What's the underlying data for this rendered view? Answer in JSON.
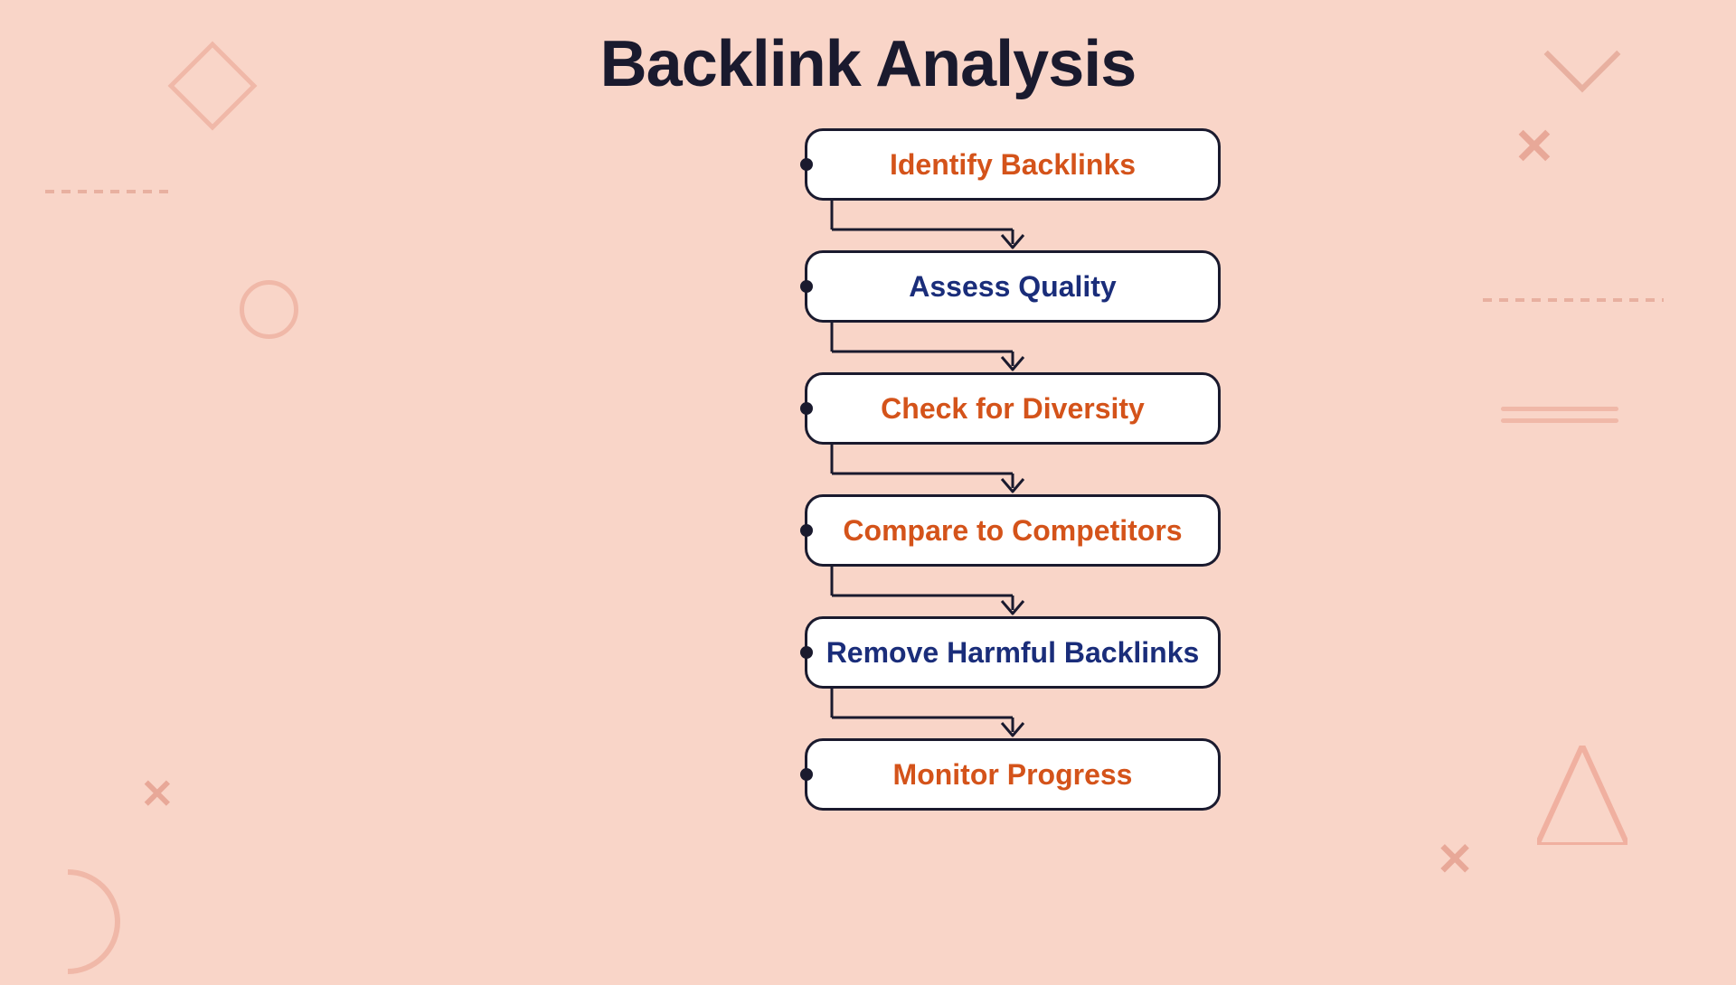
{
  "page": {
    "title": "Backlink Analysis",
    "background_color": "#f9d5c8"
  },
  "flow_steps": [
    {
      "id": 1,
      "label": "Identify Backlinks",
      "color_class": "orange-text"
    },
    {
      "id": 2,
      "label": "Assess Quality",
      "color_class": "blue-text"
    },
    {
      "id": 3,
      "label": "Check for Diversity",
      "color_class": "orange-text"
    },
    {
      "id": 4,
      "label": "Compare to Competitors",
      "color_class": "orange-text"
    },
    {
      "id": 5,
      "label": "Remove Harmful Backlinks",
      "color_class": "blue-text"
    },
    {
      "id": 6,
      "label": "Monitor Progress",
      "color_class": "orange-text"
    }
  ],
  "decorations": {
    "diamond": "◇",
    "x_mark": "✕",
    "circle": "○"
  }
}
